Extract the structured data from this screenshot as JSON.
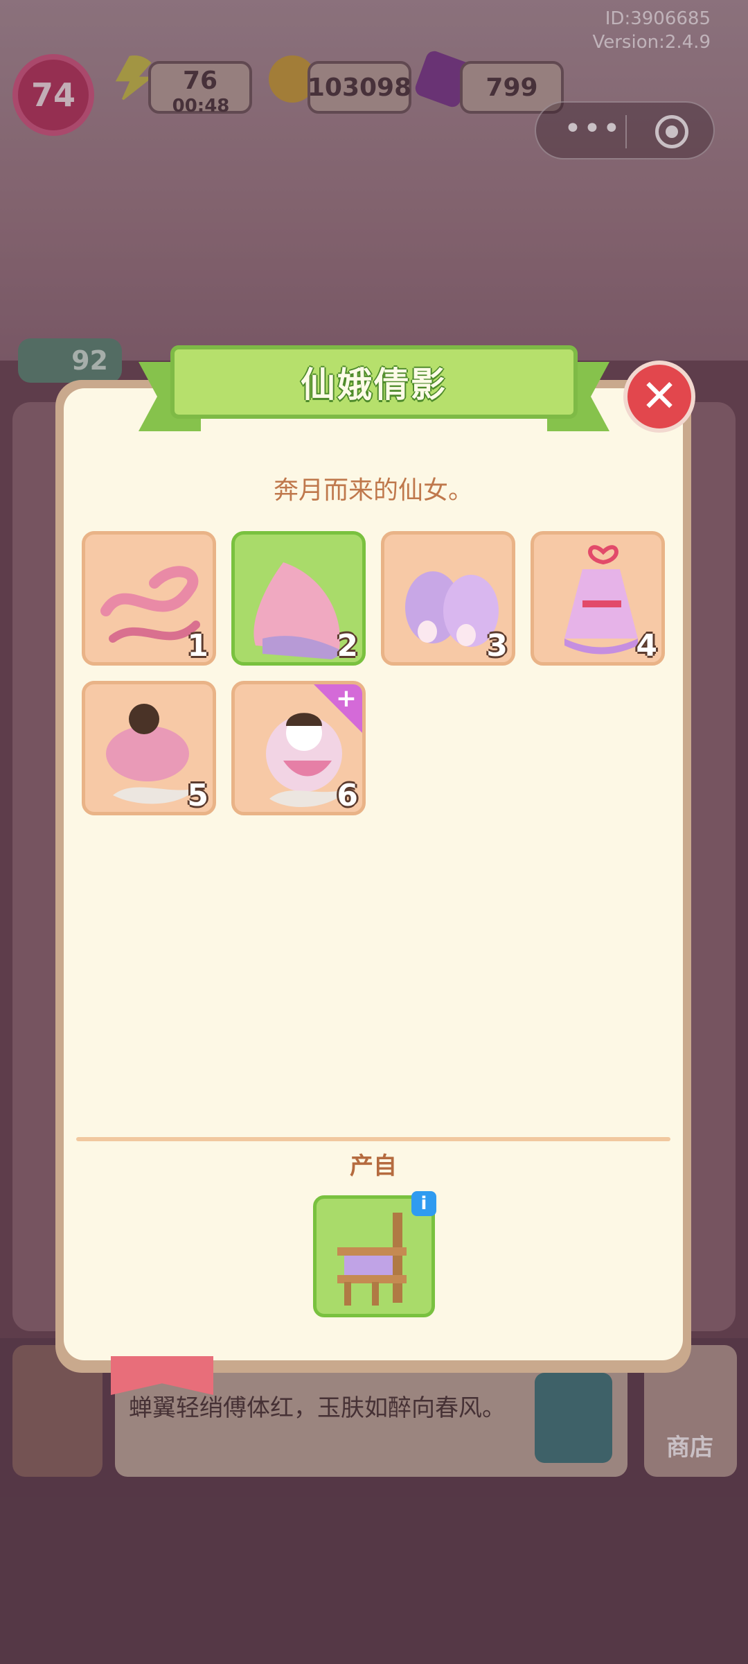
{
  "status": {
    "id_text": "ID:3906685",
    "version_text": "Version:2.4.9",
    "level": "74",
    "energy": "76",
    "energy_timer": "00:48",
    "coins": "103098",
    "gems": "799",
    "star_count": "92"
  },
  "capsule": {
    "more_icon": "more-dots-icon",
    "close_icon": "target-icon"
  },
  "modal": {
    "title": "仙娥倩影",
    "subtitle": "奔月而来的仙女。",
    "close_icon": "close-icon",
    "items": [
      {
        "level": "1",
        "icon": "pink-ribbon-sash-icon"
      },
      {
        "level": "2",
        "icon": "pink-veil-cloth-icon"
      },
      {
        "level": "3",
        "icon": "rabbit-slippers-icon"
      },
      {
        "level": "4",
        "icon": "fairy-dress-icon"
      },
      {
        "level": "5",
        "icon": "cloud-dress-icon"
      },
      {
        "level": "6",
        "icon": "fairy-duck-icon"
      }
    ],
    "selected_level": "2",
    "source_label": "产自",
    "source_item_icon": "loom-icon"
  },
  "background": {
    "description": "蝉翼轻绡傅体红，玉肤如醉向春风。",
    "shop_label": "商店"
  },
  "colors": {
    "accent_green": "#86c24c",
    "close_red": "#e2474d",
    "modal_bg": "#fdf8e5",
    "subtitle_color": "#bf784c"
  }
}
